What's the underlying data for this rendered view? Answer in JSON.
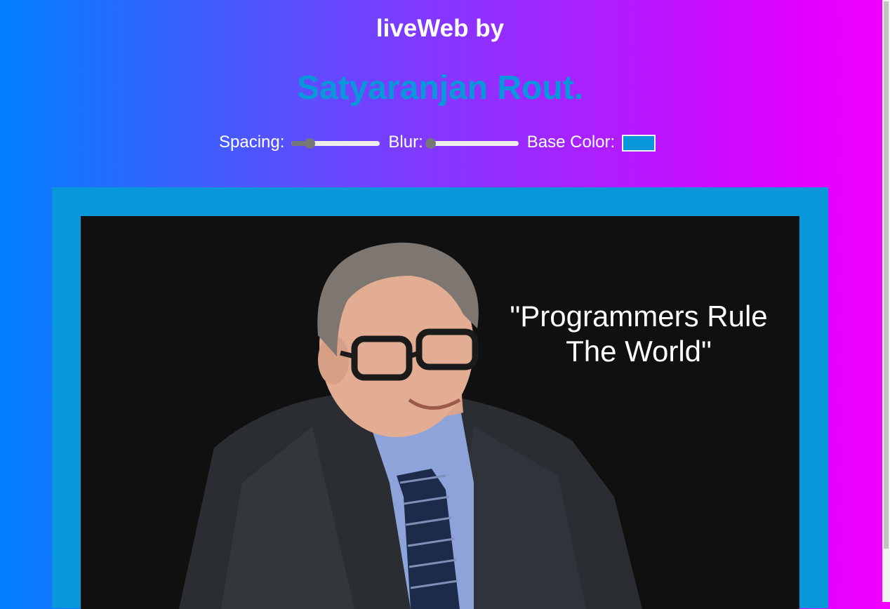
{
  "header": {
    "title": "liveWeb by",
    "author": "Satyaranjan Rout."
  },
  "controls": {
    "spacing_label": "Spacing:",
    "spacing_value": 0.2,
    "blur_label": "Blur:",
    "blur_value": 0,
    "base_color_label": "Base Color:",
    "base_color": "#0897db"
  },
  "image": {
    "quote_line1": "\"Programmers Rule",
    "quote_line2": "The World\""
  },
  "colors": {
    "accent": "#0897db",
    "gradient_start": "#0080ff",
    "gradient_end": "#f200ff"
  }
}
